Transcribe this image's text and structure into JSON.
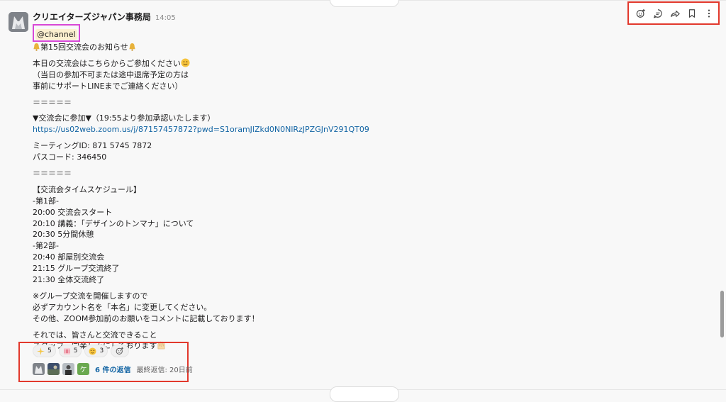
{
  "date_divider": {
    "label": ""
  },
  "message": {
    "sender": "クリエイターズジャパン事務局",
    "time": "14:05",
    "mention": "@channel",
    "lines": {
      "l1": "第15回交流会のお知らせ",
      "l2": "本日の交流会はこちらからご参加ください",
      "l3": "（当日の参加不可または途中退席予定の方は",
      "l4": "事前にサポートLINEまでご連絡ください）",
      "l5": "＝＝＝＝＝",
      "l6": "▼交流会に参加▼（19:55より参加承認いたします）",
      "l7": "https://us02web.zoom.us/j/87157457872?pwd=S1oramJlZkd0N0NlRzJPZGJnV291QT09",
      "l8": "ミーティングID: 871 5745 7872",
      "l9": "パスコード: 346450",
      "l10": "＝＝＝＝＝",
      "l11": "【交流会タイムスケジュール】",
      "l12": "-第1部-",
      "l13": "20:00 交流会スタート",
      "l14": "20:10  講義：「デザインのトンマナ」について",
      "l15": "20:30 5分間休憩",
      "l16": "-第2部-",
      "l17": "20:40 部屋別交流会",
      "l18": "21:15 グループ交流終了",
      "l19": "21:30 全体交流終了",
      "l20": "※グループ交流を開催しますので",
      "l21": "必ずアカウント名を「本名」に変更してください。",
      "l22": "その他、ZOOM参加前のお願いをコメントに記載しております！",
      "l23": "それでは、皆さんと交流できること",
      "l24": "スタッフ一同楽しみにしております"
    }
  },
  "actions": {
    "items": [
      "add-reaction-icon",
      "reply-in-thread-icon",
      "share-icon",
      "bookmark-icon",
      "more-actions-icon"
    ]
  },
  "reactions": [
    {
      "emoji": "sparkles-icon",
      "count": "5"
    },
    {
      "emoji": "clap-icon",
      "count": "5"
    },
    {
      "emoji": "relieved-face-icon",
      "count": "3"
    }
  ],
  "thread": {
    "reply_count": "6 件の返信",
    "last_reply": "最終返信: 20日前"
  },
  "colors": {
    "link": "#1264a3",
    "highlight_box": "#e2382c",
    "mention_box": "#d848d6",
    "mention_bg": "#fcefcf"
  }
}
